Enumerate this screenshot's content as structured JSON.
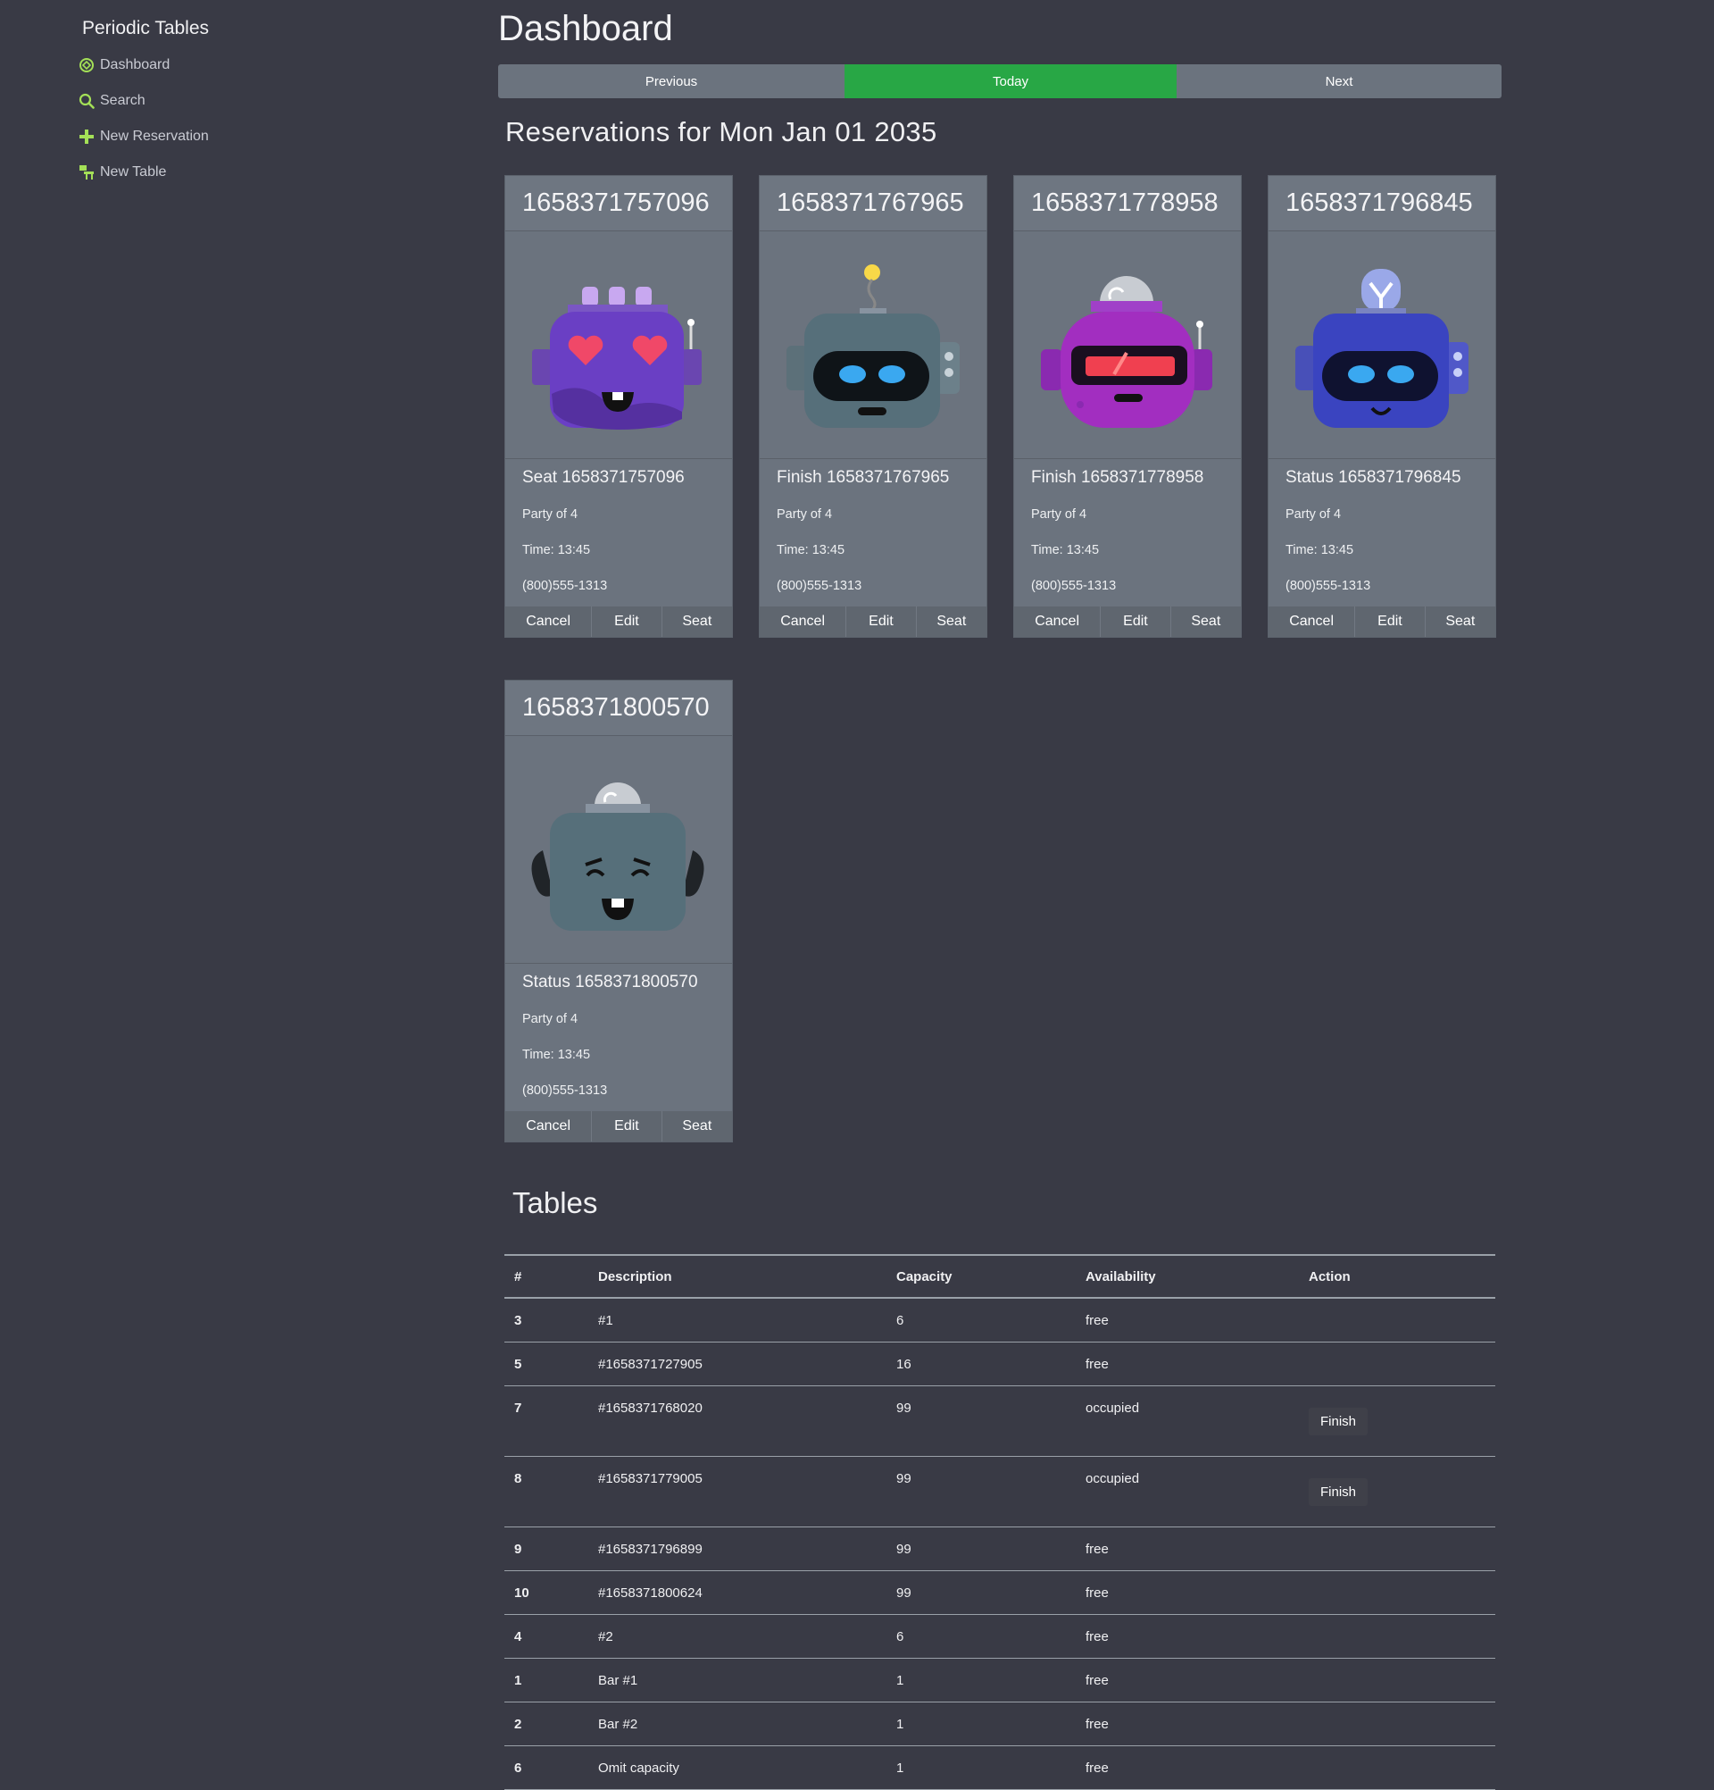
{
  "sidebar": {
    "brand": "Periodic Tables",
    "items": [
      {
        "label": "Dashboard",
        "icon": "dashboard-icon"
      },
      {
        "label": "Search",
        "icon": "search-icon"
      },
      {
        "label": "New Reservation",
        "icon": "plus-icon"
      },
      {
        "label": "New Table",
        "icon": "new-table-icon"
      }
    ],
    "accent": "#a4e057"
  },
  "main": {
    "title": "Dashboard",
    "date_nav": {
      "previous": "Previous",
      "today": "Today",
      "next": "Next"
    },
    "reservations_heading": "Reservations for Mon Jan 01 2035",
    "reservations": [
      {
        "id": "1658371757096",
        "title": "Seat 1658371757096",
        "party": "Party of 4",
        "time": "Time: 13:45",
        "phone": "(800)555-1313",
        "robot": "purple-heart-robot"
      },
      {
        "id": "1658371767965",
        "title": "Finish 1658371767965",
        "party": "Party of 4",
        "time": "Time: 13:45",
        "phone": "(800)555-1313",
        "robot": "teal-antenna-robot"
      },
      {
        "id": "1658371778958",
        "title": "Finish 1658371778958",
        "party": "Party of 4",
        "time": "Time: 13:45",
        "phone": "(800)555-1313",
        "robot": "magenta-visor-robot"
      },
      {
        "id": "1658371796845",
        "title": "Status 1658371796845",
        "party": "Party of 4",
        "time": "Time: 13:45",
        "phone": "(800)555-1313",
        "robot": "blue-bulb-robot"
      },
      {
        "id": "1658371800570",
        "title": "Status 1658371800570",
        "party": "Party of 4",
        "time": "Time: 13:45",
        "phone": "(800)555-1313",
        "robot": "teal-laughing-robot"
      }
    ],
    "card_actions": {
      "cancel": "Cancel",
      "edit": "Edit",
      "seat": "Seat"
    },
    "tables_heading": "Tables",
    "tables_columns": [
      "#",
      "Description",
      "Capacity",
      "Availability",
      "Action"
    ],
    "tables_rows": [
      {
        "num": "3",
        "desc": "#1",
        "cap": "6",
        "avail": "free",
        "action": ""
      },
      {
        "num": "5",
        "desc": "#1658371727905",
        "cap": "16",
        "avail": "free",
        "action": ""
      },
      {
        "num": "7",
        "desc": "#1658371768020",
        "cap": "99",
        "avail": "occupied",
        "action": "Finish"
      },
      {
        "num": "8",
        "desc": "#1658371779005",
        "cap": "99",
        "avail": "occupied",
        "action": "Finish"
      },
      {
        "num": "9",
        "desc": "#1658371796899",
        "cap": "99",
        "avail": "free",
        "action": ""
      },
      {
        "num": "10",
        "desc": "#1658371800624",
        "cap": "99",
        "avail": "free",
        "action": ""
      },
      {
        "num": "4",
        "desc": "#2",
        "cap": "6",
        "avail": "free",
        "action": ""
      },
      {
        "num": "1",
        "desc": "Bar #1",
        "cap": "1",
        "avail": "free",
        "action": ""
      },
      {
        "num": "2",
        "desc": "Bar #2",
        "cap": "1",
        "avail": "free",
        "action": ""
      },
      {
        "num": "6",
        "desc": "Omit capacity",
        "cap": "1",
        "avail": "free",
        "action": ""
      }
    ]
  },
  "colors": {
    "background": "#393a45",
    "card": "#6b737e",
    "today": "#28a745",
    "nav_button": "#6b737e"
  }
}
